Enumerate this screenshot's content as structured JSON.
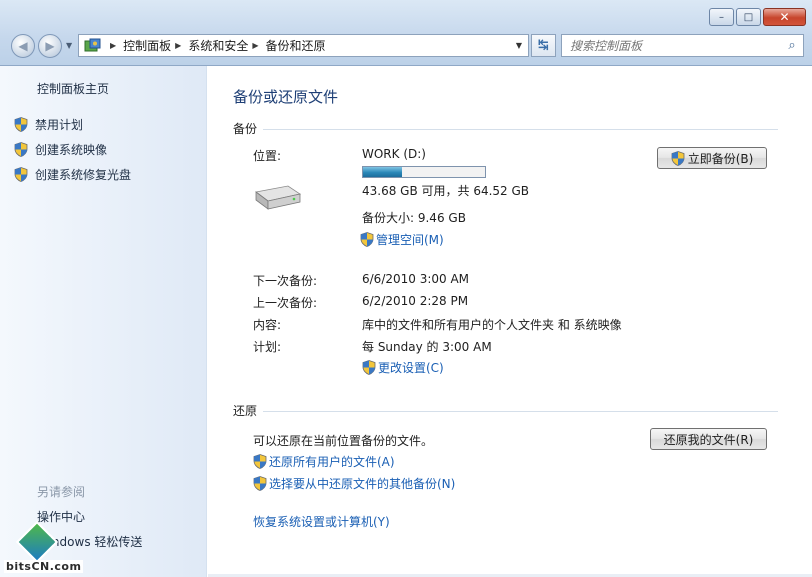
{
  "window": {
    "minimize_label": "–",
    "maximize_label": "□",
    "close_label": "✕"
  },
  "nav": {
    "back_label": "◀",
    "forward_label": "▶",
    "history_label": "▼"
  },
  "address": {
    "crumbs": [
      "控制面板",
      "系统和安全",
      "备份和还原"
    ],
    "separator": "▶",
    "dropdown_label": "▼",
    "refresh_label": "↹"
  },
  "search": {
    "placeholder": "搜索控制面板",
    "icon_label": "⌕"
  },
  "help": {
    "label": "?"
  },
  "sidebar": {
    "home": "控制面板主页",
    "items": [
      {
        "label": "禁用计划"
      },
      {
        "label": "创建系统映像"
      },
      {
        "label": "创建系统修复光盘"
      }
    ],
    "see_also": "另请参阅",
    "see_also_links": [
      {
        "label": "操作中心"
      },
      {
        "label": "Windows 轻松传送"
      }
    ]
  },
  "watermark": {
    "text": "bitsCN.com"
  },
  "main": {
    "title": "备份或还原文件",
    "backup": {
      "section_title": "备份",
      "location_label": "位置:",
      "drive_name": "WORK (D:)",
      "drive_usage_fraction": 0.32,
      "drive_space": "43.68 GB 可用，共 64.52 GB",
      "backup_size": "备份大小: 9.46 GB",
      "manage_space": "管理空间(M)",
      "backup_now": "立即备份(B)",
      "next_backup_label": "下一次备份:",
      "next_backup_value": "6/6/2010 3:00 AM",
      "last_backup_label": "上一次备份:",
      "last_backup_value": "6/2/2010 2:28 PM",
      "contents_label": "内容:",
      "contents_value": "库中的文件和所有用户的个人文件夹 和 系统映像",
      "schedule_label": "计划:",
      "schedule_value": "每 Sunday 的 3:00 AM",
      "change_settings": "更改设置(C)"
    },
    "restore": {
      "section_title": "还原",
      "description": "可以还原在当前位置备份的文件。",
      "restore_my_files": "还原我的文件(R)",
      "restore_all_users": "还原所有用户的文件(A)",
      "select_other_backup": "选择要从中还原文件的其他备份(N)",
      "recover_system": "恢复系统设置或计算机(Y)"
    }
  },
  "colors": {
    "link": "#1a5fb4",
    "title": "#1e3f76",
    "sidebar_bg": "#e6eef8"
  }
}
